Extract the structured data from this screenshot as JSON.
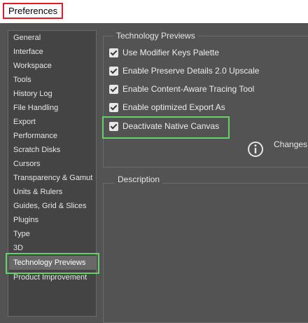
{
  "window": {
    "title": "Preferences"
  },
  "sidebar": {
    "items": [
      {
        "label": "General"
      },
      {
        "label": "Interface"
      },
      {
        "label": "Workspace"
      },
      {
        "label": "Tools"
      },
      {
        "label": "History Log"
      },
      {
        "label": "File Handling"
      },
      {
        "label": "Export"
      },
      {
        "label": "Performance"
      },
      {
        "label": "Scratch Disks"
      },
      {
        "label": "Cursors"
      },
      {
        "label": "Transparency & Gamut"
      },
      {
        "label": "Units & Rulers"
      },
      {
        "label": "Guides, Grid & Slices"
      },
      {
        "label": "Plugins"
      },
      {
        "label": "Type"
      },
      {
        "label": "3D"
      },
      {
        "label": "Technology Previews",
        "selected": true
      },
      {
        "label": "Product Improvement"
      }
    ]
  },
  "tech_previews": {
    "title": "Technology Previews",
    "options": [
      {
        "label": "Use Modifier Keys Palette",
        "checked": true
      },
      {
        "label": "Enable Preserve Details 2.0 Upscale",
        "checked": true
      },
      {
        "label": "Enable Content-Aware Tracing Tool",
        "checked": true
      },
      {
        "label": "Enable optimized Export As",
        "checked": true
      },
      {
        "label": "Deactivate Native Canvas",
        "checked": true
      }
    ],
    "info_text": "Changes",
    "info_icon": "info-icon"
  },
  "description": {
    "title": "Description"
  },
  "colors": {
    "highlight_red": "#e01b24",
    "highlight_green": "#66d06a"
  }
}
